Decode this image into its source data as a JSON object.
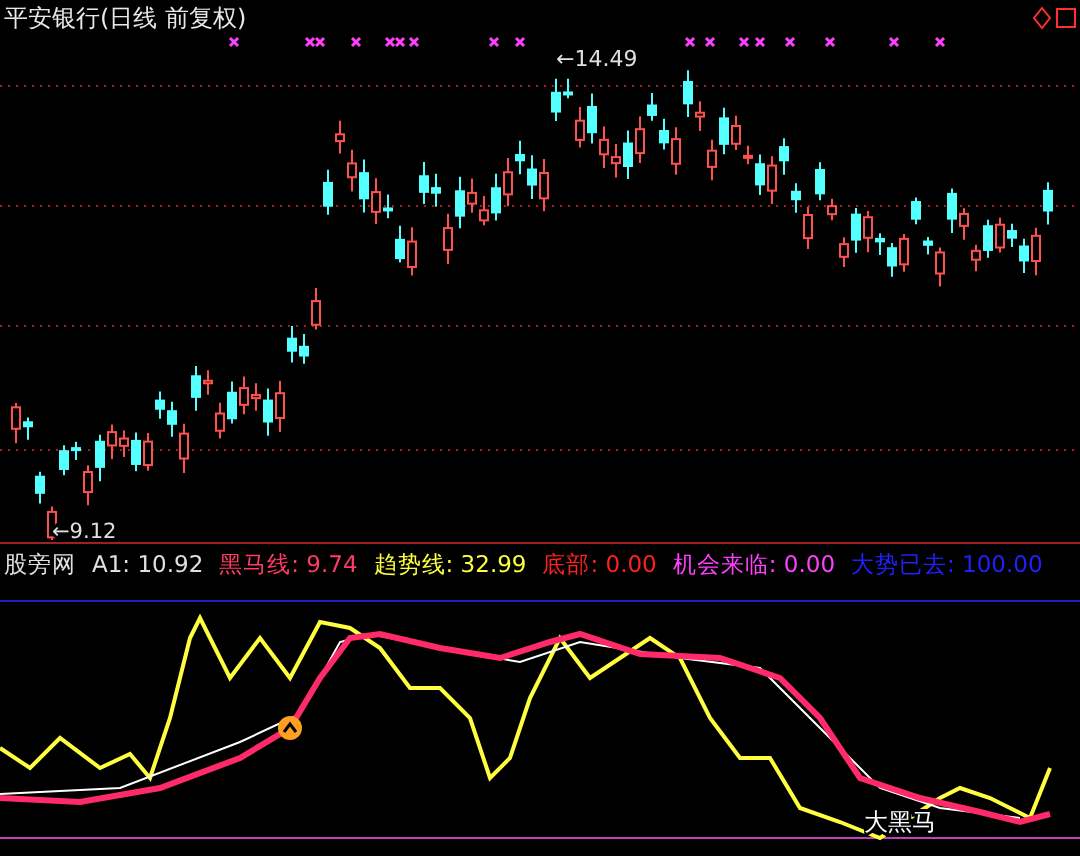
{
  "chart": {
    "title": "平安银行(日线 前复权)",
    "high_label": "←14.49",
    "low_label": "←9.12"
  },
  "indicator": {
    "name": "股旁网",
    "values": [
      {
        "label": "A1:",
        "value": "10.92",
        "color": "#e0e0e0"
      },
      {
        "label": "黑马线:",
        "value": "9.74",
        "color": "#ff3c64"
      },
      {
        "label": "趋势线:",
        "value": "32.99",
        "color": "#ffff40"
      },
      {
        "label": "底部:",
        "value": "0.00",
        "color": "#ff2020"
      },
      {
        "label": "机会来临:",
        "value": "0.00",
        "color": "#ff40ff"
      },
      {
        "label": "大势已去:",
        "value": "100.00",
        "color": "#2020ff"
      }
    ],
    "signal_label": "大黑马"
  }
}
